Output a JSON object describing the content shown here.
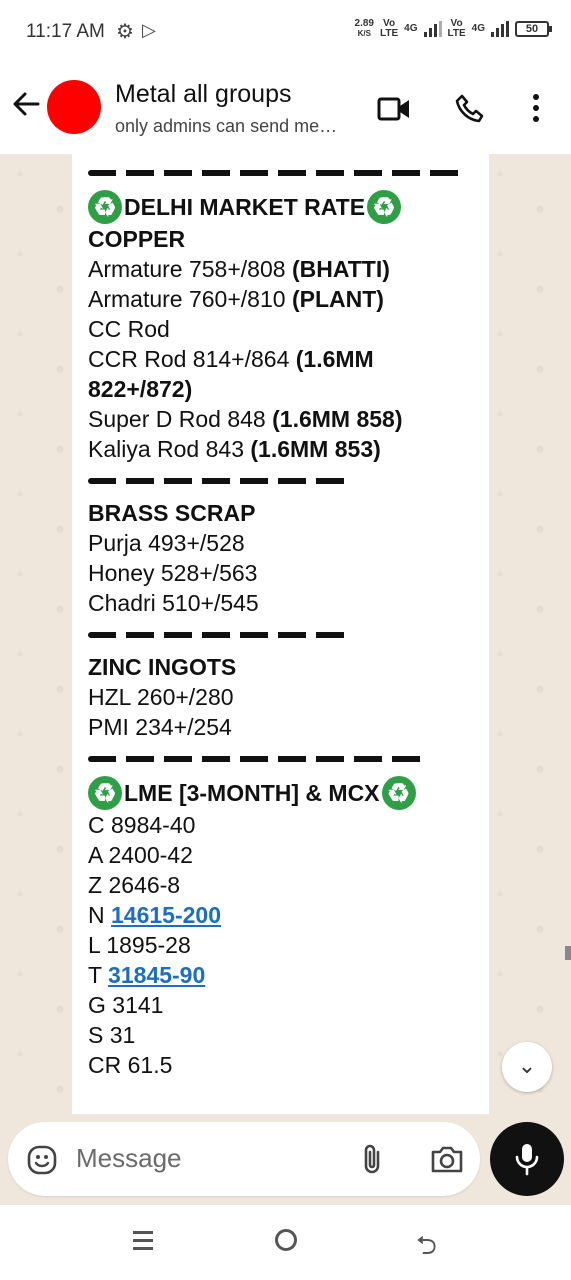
{
  "status_bar": {
    "time": "11:17 AM",
    "net_speed": "2.89",
    "net_unit": "K/S",
    "sim1_vo": "Vo",
    "sim1_lte": "LTE",
    "sim1_type": "4G",
    "sim2_vo": "Vo",
    "sim2_lte": "LTE",
    "sim2_type": "4G",
    "battery": "50"
  },
  "header": {
    "title": "Metal all groups",
    "subtitle": "only admins can send me…",
    "avatar_color": "#ff0000"
  },
  "message": {
    "delhi_title": "DELHI MARKET RATE",
    "copper_heading": "COPPER",
    "copper_lines": [
      {
        "text": "Armature 758+/808 ",
        "bold": "(BHATTI)"
      },
      {
        "text": "Armature 760+/810 ",
        "bold": "(PLANT)"
      },
      {
        "text": "CC Rod",
        "bold": ""
      },
      {
        "text": "CCR Rod  814+/864 ",
        "bold": "(1.6MM"
      },
      {
        "text": "",
        "bold": "822+/872)"
      },
      {
        "text": "Super D Rod 848 ",
        "bold": "(1.6MM 858)"
      },
      {
        "text": "Kaliya Rod    843 ",
        "bold": "(1.6MM 853)"
      }
    ],
    "brass_heading": "BRASS SCRAP",
    "brass_lines": [
      "Purja    493+/528",
      "Honey  528+/563",
      "Chadri  510+/545"
    ],
    "zinc_heading": "ZINC INGOTS",
    "zinc_lines": [
      "HZL  260+/280",
      "PMI  234+/254"
    ],
    "lme_title": "LME [3-MONTH] & MCX",
    "lme_lines": [
      {
        "prefix": "C 8984-40",
        "link": ""
      },
      {
        "prefix": "A 2400-42",
        "link": ""
      },
      {
        "prefix": "Z 2646-8",
        "link": ""
      },
      {
        "prefix": "N ",
        "link": "14615-200"
      },
      {
        "prefix": "L 1895-28",
        "link": ""
      },
      {
        "prefix": "T ",
        "link": "31845-90"
      },
      {
        "prefix": "G 3141",
        "link": ""
      },
      {
        "prefix": "S 31",
        "link": ""
      },
      {
        "prefix": "CR 61.5",
        "link": ""
      }
    ]
  },
  "composer": {
    "placeholder": "Message"
  },
  "icons": {
    "back": "back-arrow-icon",
    "video": "video-call-icon",
    "call": "phone-call-icon",
    "menu": "more-vert-icon",
    "emoji": "emoji-icon",
    "attach": "attach-icon",
    "camera": "camera-icon",
    "mic": "mic-icon",
    "recycle": "recycle-icon",
    "scroll": "scroll-down-icon"
  }
}
